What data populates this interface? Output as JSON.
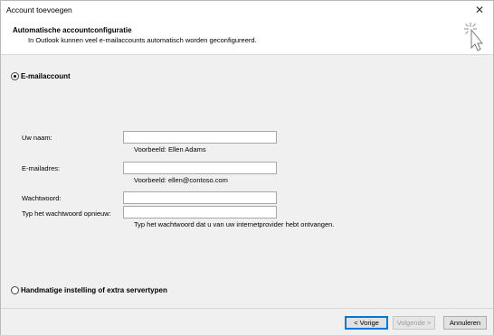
{
  "window": {
    "title": "Account toevoegen",
    "close_glyph": "✕"
  },
  "header": {
    "title": "Automatische accountconfiguratie",
    "subtitle": "In Outlook kunnen veel e-mailaccounts automatisch worden geconfigureerd.",
    "icon": "wizard-cursor-icon"
  },
  "options": {
    "email_account_label": "E-mailaccount",
    "email_account_selected": true,
    "manual_label": "Handmatige instelling of extra servertypen",
    "manual_selected": false
  },
  "form": {
    "name": {
      "label": "Uw naam:",
      "value": "",
      "hint": "Voorbeeld: Ellen Adams"
    },
    "email": {
      "label": "E-mailadres:",
      "value": "",
      "hint": "Voorbeeld: ellen@contoso.com"
    },
    "password": {
      "label": "Wachtwoord:",
      "value": ""
    },
    "password_repeat": {
      "label": "Typ het wachtwoord opnieuw:",
      "value": "",
      "hint": "Typ het wachtwoord dat u van uw internetprovider hebt ontvangen."
    }
  },
  "buttons": {
    "back": "< Vorige",
    "next": "Volgende >",
    "cancel": "Annuleren"
  },
  "colors": {
    "accent": "#0078d7",
    "window_bg": "#f0f0f0",
    "header_bg": "#ffffff"
  }
}
